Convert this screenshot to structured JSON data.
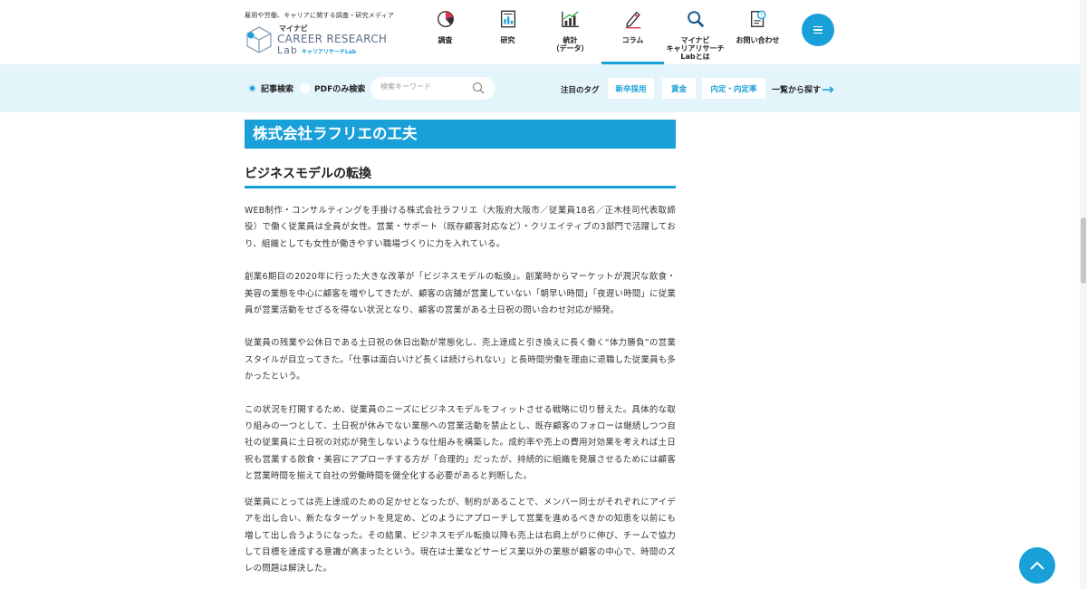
{
  "header": {
    "tagline": "雇用や労働、キャリアに関する調査・研究メディア",
    "logo": {
      "brand": "マイナビ",
      "line1": "CAREER RESEARCH",
      "line2": "Lab",
      "sub": "キャリアリサーチLab"
    },
    "nav": [
      {
        "label": "調査",
        "icon": "pie-chart-icon"
      },
      {
        "label": "研究",
        "icon": "report-icon"
      },
      {
        "label": "統計\n（データ）",
        "icon": "bar-chart-icon"
      },
      {
        "label": "コラム",
        "icon": "pen-icon",
        "active": true
      },
      {
        "label": "マイナビ\nキャリアリサーチ\nLabとは",
        "icon": "magnifier-icon"
      },
      {
        "label": "お問い合わせ",
        "icon": "contact-icon"
      }
    ],
    "menu_icon": "hamburger-icon"
  },
  "search": {
    "option_article": "記事検索",
    "option_pdf": "PDFのみ検索",
    "selected": "記事検索",
    "placeholder": "検索キーワード",
    "tags_label": "注目のタグ",
    "tags": [
      "新卒採用",
      "賃金",
      "内定・内定率"
    ],
    "browse_all": "一覧から探す"
  },
  "article": {
    "h2": "株式会社ラフリエの工夫",
    "h3": "ビジネスモデルの転換",
    "paragraphs": [
      "WEB制作・コンサルティングを手掛ける株式会社ラフリエ（大阪府大阪市／従業員18名／正木桂司代表取締役）で働く従業員は全員が女性。営業・サポート（既存顧客対応など）・クリエイティブの3部門で活躍しており、組織としても女性が働きやすい職場づくりに力を入れている。",
      "創業6期目の2020年に行った大きな改革が「ビジネスモデルの転換」。創業時からマーケットが潤沢な飲食・美容の業態を中心に顧客を増やしてきたが、顧客の店舗が営業していない「朝早い時間」「夜遅い時間」に従業員が営業活動をせざるを得ない状況となり、顧客の営業がある土日祝の問い合わせ対応が頻発。",
      "従業員の残業や公休日である土日祝の休日出勤が常態化し、売上達成と引き換えに長く働く“体力勝負”の営業スタイルが目立ってきた。「仕事は面白いけど長くは続けられない」と長時間労働を理由に退職した従業員も多かったという。",
      "この状況を打開するため、従業員のニーズにビジネスモデルをフィットさせる戦略に切り替えた。具体的な取り組みの一つとして、土日祝が休みでない業態への営業活動を禁止とし、既存顧客のフォローは継続しつつ自社の従業員に土日祝の対応が発生しないような仕組みを構築した。成約率や売上の費用対効果を考えれば土日祝も営業する飲食・美容にアプローチする方が「合理的」だったが、持続的に組織を発展させるためには顧客と営業時間を揃えて自社の労働時間を健全化する必要があると判断した。",
      "従業員にとっては売上達成のための足かせとなったが、制約があることで、メンバー同士がそれぞれにアイデアを出し合い、新たなターゲットを見定め、どのようにアプローチして営業を進めるべきかの知恵を以前にも増して出し合うようになった。その結果、ビジネスモデル転換以降も売上は右肩上がりに伸び、チームで協力して目標を達成する意識が高まったという。現在は士業などサービス業以外の業態が顧客の中心で、時間のズレの問題は解決した。"
    ]
  },
  "back_to_top_icon": "chevron-up-icon",
  "colors": {
    "accent": "#1aa0d8",
    "search_bg": "#e3f4fb"
  }
}
